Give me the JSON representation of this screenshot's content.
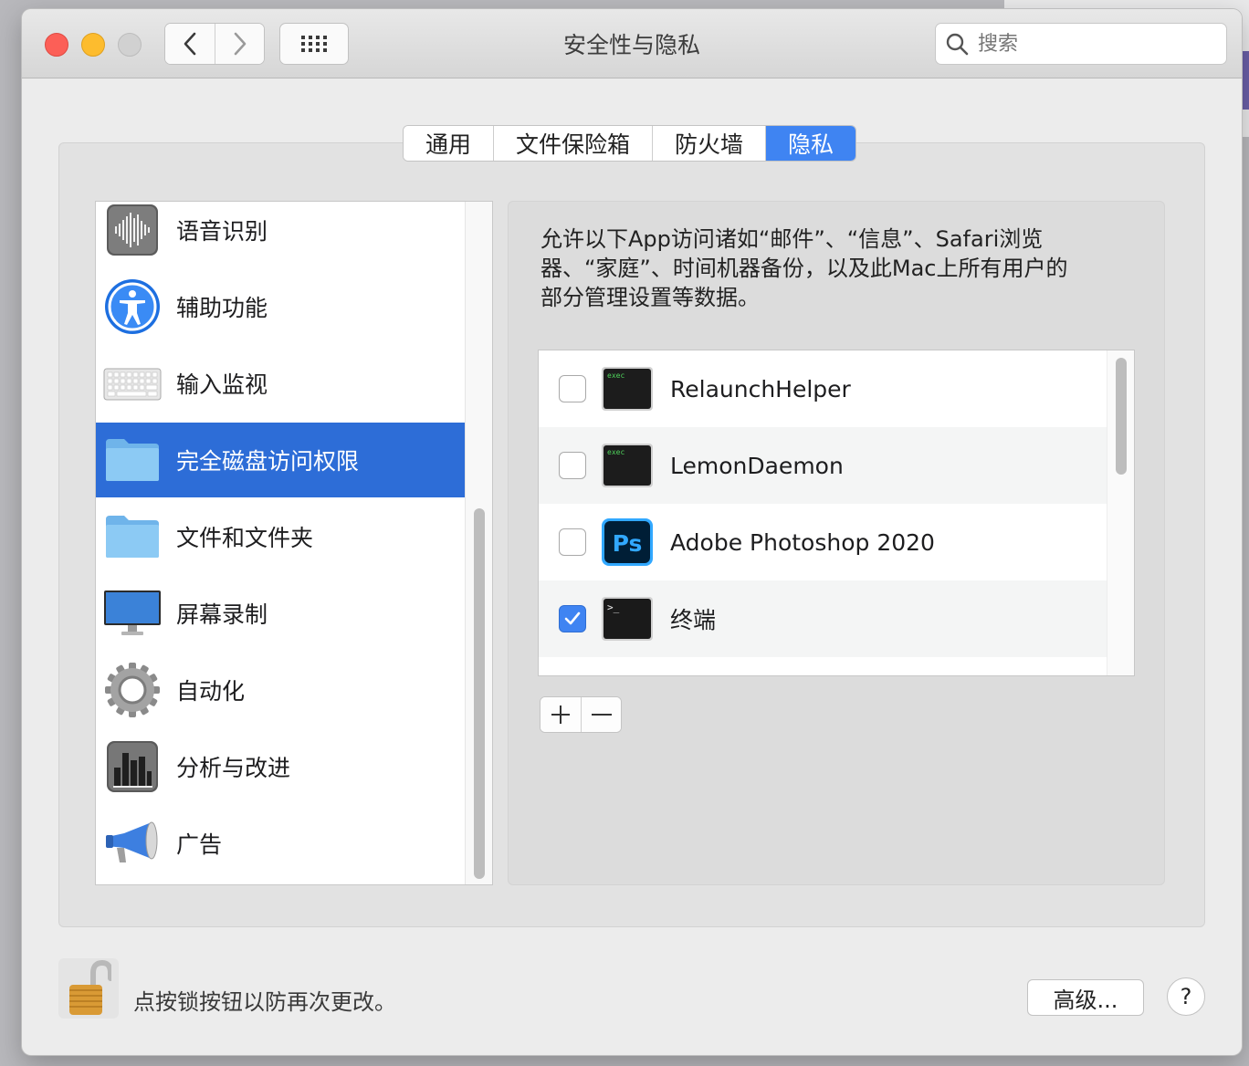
{
  "window": {
    "title": "安全性与隐私"
  },
  "search": {
    "placeholder": "搜索"
  },
  "tabs": [
    {
      "label": "通用",
      "active": false
    },
    {
      "label": "文件保险箱",
      "active": false
    },
    {
      "label": "防火墙",
      "active": false
    },
    {
      "label": "隐私",
      "active": true
    }
  ],
  "sidebar": {
    "items": [
      {
        "label": "语音识别",
        "icon": "speech-recognition-icon",
        "selected": false
      },
      {
        "label": "辅助功能",
        "icon": "accessibility-icon",
        "selected": false
      },
      {
        "label": "输入监视",
        "icon": "keyboard-icon",
        "selected": false
      },
      {
        "label": "完全磁盘访问权限",
        "icon": "folder-icon",
        "selected": true
      },
      {
        "label": "文件和文件夹",
        "icon": "folder-icon",
        "selected": false
      },
      {
        "label": "屏幕录制",
        "icon": "display-icon",
        "selected": false
      },
      {
        "label": "自动化",
        "icon": "gear-icon",
        "selected": false
      },
      {
        "label": "分析与改进",
        "icon": "bar-chart-icon",
        "selected": false
      },
      {
        "label": "广告",
        "icon": "megaphone-icon",
        "selected": false
      }
    ]
  },
  "main": {
    "description_lines": [
      "允许以下App访问诸如“邮件”、“信息”、Safari浏览",
      "器、“家庭”、时间机器备份，以及此Mac上所有用户的",
      "部分管理设置等数据。"
    ],
    "apps": [
      {
        "name": "RelaunchHelper",
        "checked": false,
        "icon": "exec-terminal-icon",
        "icon_text": "exec"
      },
      {
        "name": "LemonDaemon",
        "checked": false,
        "icon": "exec-terminal-icon",
        "icon_text": "exec"
      },
      {
        "name": "Adobe Photoshop 2020",
        "checked": false,
        "icon": "photoshop-icon",
        "icon_text": "Ps"
      },
      {
        "name": "终端",
        "checked": true,
        "icon": "terminal-icon",
        "icon_text": ">_"
      }
    ],
    "add_label": "+",
    "remove_label": "—"
  },
  "footer": {
    "lock_text": "点按锁按钮以防再次更改。",
    "advanced_label": "高级...",
    "help_label": "?"
  },
  "colors": {
    "accent": "#3f84f2",
    "selection": "#2d6dd7"
  }
}
